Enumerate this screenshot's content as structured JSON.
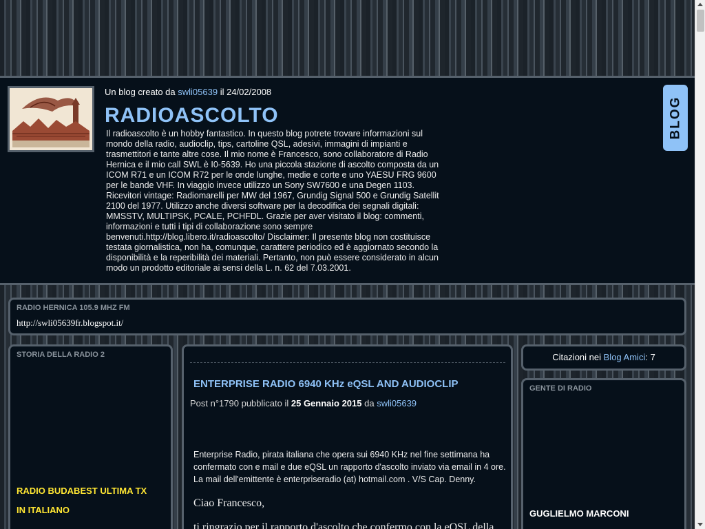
{
  "header": {
    "created_prefix": "Un blog creato da",
    "author": "swli05639",
    "created_suffix": "il 24/02/2008",
    "title": "RADIOASCOLTO",
    "description": "Il radioascolto è un hobby fantastico. In questo blog potrete trovare informazioni sul mondo della radio, audioclip, tips, cartoline QSL, adesivi, immagini di impianti e trasmettitori e tante altre cose. Il mio nome è Francesco, sono collaboratore di Radio Hernica e il mio call SWL è I0-5639. Ho una piccola stazione di ascolto composta da un ICOM R71 e un ICOM R72 per le onde lunghe, medie e corte e uno YAESU FRG 9600 per le bande VHF. In viaggio invece utilizzo un Sony SW7600 e una Degen 1103. Ricevitori vintage: Radiomarelli per MW del 1967, Grundig Signal 500 e Grundig Satellit 2100 del 1977. Utilizzo anche diversi software per la decodifica dei segnali digitali: MMSSTV, MULTIPSK, PCALE, PCHFDL. Grazie per aver visitato il blog: commenti, informazioni e tutti i tipi di collaborazione sono sempre benvenuti.http://blog.libero.it/radioascolto/ Disclaimer: Il presente blog non costituisce testata giornalistica, non ha, comunque, carattere periodico ed è aggiornato secondo la disponibilità e la reperibilità dei materiali. Pertanto, non può essere considerato in alcun modo un prodotto editoriale ai sensi della L. n. 62 del 7.03.2001.",
    "badge": "BLOG"
  },
  "radio_panel": {
    "title": "RADIO HERNICA 105.9 MHZ FM",
    "url": "http://swli05639fr.blogspot.it/"
  },
  "left_panel": {
    "title": "STORIA DELLA RADIO 2",
    "line1": "RADIO BUDABEST ULTIMA TX",
    "line2": "IN ITALIANO"
  },
  "post": {
    "title": "ENTERPRISE RADIO 6940 KHz eQSL AND AUDIOCLIP",
    "meta_prefix": "Post n°1790 pubblicato il",
    "date": "25 Gennaio 2015",
    "meta_by": "da",
    "author": "swli05639",
    "body": "Enterprise Radio, pirata italiana che opera sui 6940 KHz nel fine settimana ha confermato con e mail e due eQSL un rapporto d'ascolto inviato via email in 4 ore. La mail dell'emittente è enterpriseradio (at) hotmail.com . V/S Cap. Denny.",
    "greeting": "Ciao Francesco,",
    "body2": "ti ringrazio per il rapporto d'ascolto che confermo con la eQSL della"
  },
  "citations": {
    "prefix": "Citazioni nei",
    "link": "Blog Amici",
    "count": ": 7"
  },
  "right_panel": {
    "title": "GENTE DI RADIO",
    "item": "GUGLIELMO MARCONI"
  },
  "colors": {
    "background": "#2a333c",
    "panel": "#06101a",
    "border": "#56616c",
    "link": "#8fc2f7",
    "highlight": "#ffe633"
  }
}
